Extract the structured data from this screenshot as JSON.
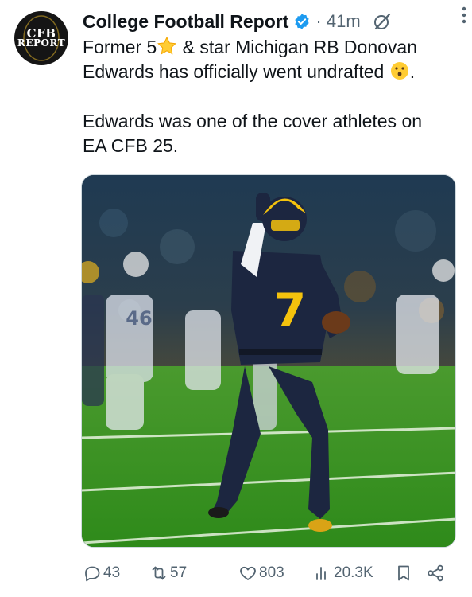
{
  "tweet": {
    "author_name": "College Football Report",
    "separator": "·",
    "time": "41m",
    "avatar_text": [
      "CFB",
      "REPORT"
    ],
    "lines": [
      {
        "before": "Former 5",
        "emoji": "star",
        "after": " & star Michigan RB Donovan"
      },
      {
        "text": "Edwards has officially went undrafted",
        "emoji": "surprised-face",
        "after": "."
      },
      {
        "text": "Edwards was one of the cover athletes on"
      },
      {
        "text": "EA CFB 25."
      }
    ],
    "media": {
      "jersey_number": "7",
      "opponent_number": "46"
    }
  },
  "actions": {
    "replies": "43",
    "reposts": "57",
    "likes": "803",
    "views": "20.3K"
  },
  "colors": {
    "verified": "#1d9bf0",
    "muted": "#536471",
    "text": "#0f1419",
    "maize": "#f4c20d",
    "navy": "#1c2640"
  }
}
